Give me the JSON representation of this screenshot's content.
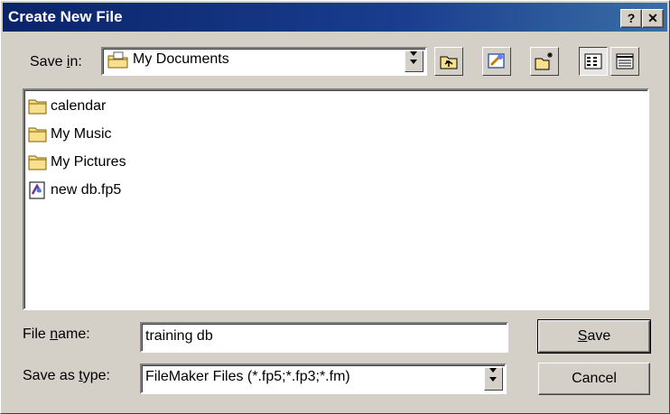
{
  "window": {
    "title": "Create New File",
    "help_label": "?",
    "close_label": "✕"
  },
  "save_in": {
    "label_pre": "Save ",
    "label_u": "i",
    "label_post": "n:",
    "value": "My Documents"
  },
  "toolbar": {
    "icons": [
      "up-one-level-icon",
      "search-web-icon",
      "new-folder-icon",
      "list-view-icon",
      "details-view-icon"
    ]
  },
  "files": [
    {
      "name": "calendar",
      "type": "folder"
    },
    {
      "name": "My Music",
      "type": "folder"
    },
    {
      "name": "My Pictures",
      "type": "folder"
    },
    {
      "name": "new db.fp5",
      "type": "filemaker-file"
    }
  ],
  "file_name": {
    "label_pre": "File ",
    "label_u": "n",
    "label_post": "ame:",
    "value": "training db"
  },
  "save_as_type": {
    "label_pre": "Save as ",
    "label_u": "t",
    "label_post": "ype:",
    "value": "FileMaker Files (*.fp5;*.fp3;*.fm)"
  },
  "buttons": {
    "save_u": "S",
    "save_rest": "ave",
    "cancel": "Cancel"
  }
}
